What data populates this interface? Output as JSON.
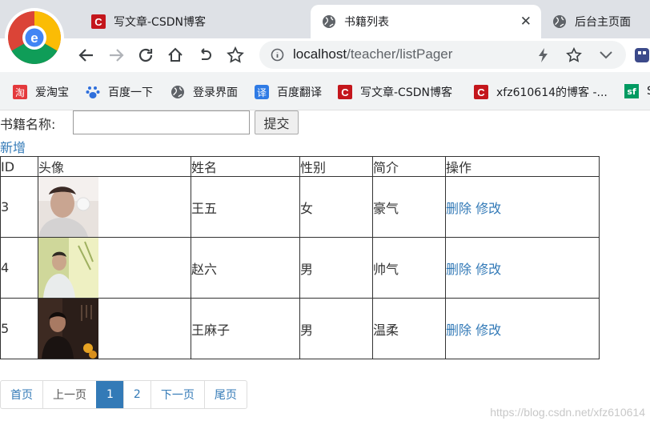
{
  "browser": {
    "tabs": [
      {
        "title": "写文章-CSDN博客",
        "icon": "csdn-icon",
        "active": false
      },
      {
        "title": "书籍列表",
        "icon": "globe-icon",
        "active": true
      },
      {
        "title": "后台主页面",
        "icon": "globe-icon",
        "active": false
      }
    ],
    "address": {
      "host": "localhost",
      "path": "/teacher/listPager"
    },
    "bookmarks": [
      {
        "label": "爱淘宝",
        "icon": "taobao-icon"
      },
      {
        "label": "百度一下",
        "icon": "baidu-paw-icon"
      },
      {
        "label": "登录界面",
        "icon": "globe-icon"
      },
      {
        "label": "百度翻译",
        "icon": "translate-icon"
      },
      {
        "label": "写文章-CSDN博客",
        "icon": "csdn-icon"
      },
      {
        "label": "xfz610614的博客 -...",
        "icon": "csdn-icon"
      },
      {
        "label": "S",
        "icon": "sf-icon"
      }
    ],
    "bookmark_icon_texts": {
      "taobao": "淘",
      "translate": "译",
      "csdn": "C",
      "sf": "sf"
    }
  },
  "search": {
    "label": "书籍名称:",
    "value": "",
    "submit_label": "提交"
  },
  "add_link": "新增",
  "table": {
    "headers": [
      "ID",
      "头像",
      "姓名",
      "性别",
      "简介",
      "操作"
    ],
    "rows": [
      {
        "id": "3",
        "name": "王五",
        "gender": "女",
        "intro": "豪气",
        "delete": "删除",
        "edit": "修改"
      },
      {
        "id": "4",
        "name": "赵六",
        "gender": "男",
        "intro": "帅气",
        "delete": "删除",
        "edit": "修改"
      },
      {
        "id": "5",
        "name": "王麻子",
        "gender": "男",
        "intro": "温柔",
        "delete": "删除",
        "edit": "修改"
      }
    ]
  },
  "pager": {
    "first": "首页",
    "prev": "上一页",
    "page1": "1",
    "page2": "2",
    "next": "下一页",
    "last": "尾页",
    "current": "1"
  },
  "watermark": "https://blog.csdn.net/xfz610614",
  "colors": {
    "link": "#337ab7",
    "pager_active": "#337ab7",
    "csdn_red": "#c4161c"
  }
}
